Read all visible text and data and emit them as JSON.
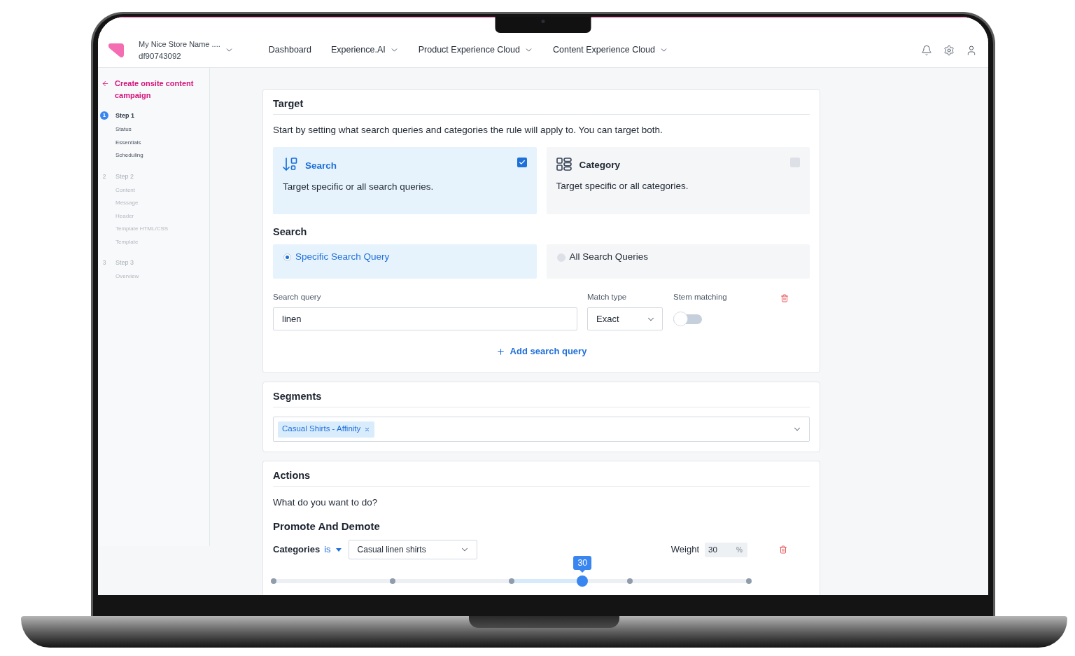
{
  "header": {
    "store_name": "My Nice Store Name ....",
    "store_id": "df90743092",
    "nav": [
      {
        "label": "Dashboard",
        "dropdown": false
      },
      {
        "label": "Experience.AI",
        "dropdown": true
      },
      {
        "label": "Product Experience Cloud",
        "dropdown": true
      },
      {
        "label": "Content Experience Cloud",
        "dropdown": true
      }
    ]
  },
  "sidebar": {
    "back_link": "Create onsite content campaign",
    "steps": [
      {
        "number": "1",
        "label": "Step 1",
        "active": true,
        "items": [
          "Status",
          "Essentials",
          "Scheduling"
        ]
      },
      {
        "number": "2",
        "label": "Step 2",
        "active": false,
        "items": [
          "Content",
          "Message",
          "Header",
          "Template HTML/CSS",
          "Template"
        ]
      },
      {
        "number": "3",
        "label": "Step 3",
        "active": false,
        "items": [
          "Overview"
        ]
      }
    ]
  },
  "target": {
    "title": "Target",
    "description": "Start by setting what search queries and categories the rule will apply to. You can target both.",
    "options": [
      {
        "kind": "search",
        "title": "Search",
        "description": "Target specific or all search queries.",
        "checked": true
      },
      {
        "kind": "category",
        "title": "Category",
        "description": "Target specific or all categories.",
        "checked": false
      }
    ]
  },
  "search": {
    "title": "Search",
    "modes": [
      {
        "label": "Specific Search Query",
        "selected": true
      },
      {
        "label": "All Search Queries",
        "selected": false
      }
    ],
    "query": {
      "label": "Search query",
      "value": "linen"
    },
    "match_type": {
      "label": "Match type",
      "value": "Exact"
    },
    "stem_matching": {
      "label": "Stem matching",
      "on": false
    },
    "add_button": "Add search query"
  },
  "segments": {
    "title": "Segments",
    "tags": [
      "Casual Shirts - Affinity"
    ]
  },
  "actions": {
    "title": "Actions",
    "prompt": "What do you want to do?",
    "rule_title": "Promote And Demote",
    "condition": {
      "field": "Categories",
      "operator": "is",
      "value": "Casual linen shirts"
    },
    "weight": {
      "label": "Weight",
      "value": "30",
      "unit": "%"
    },
    "slider": {
      "level": 0.65,
      "value_label": "30"
    }
  }
}
